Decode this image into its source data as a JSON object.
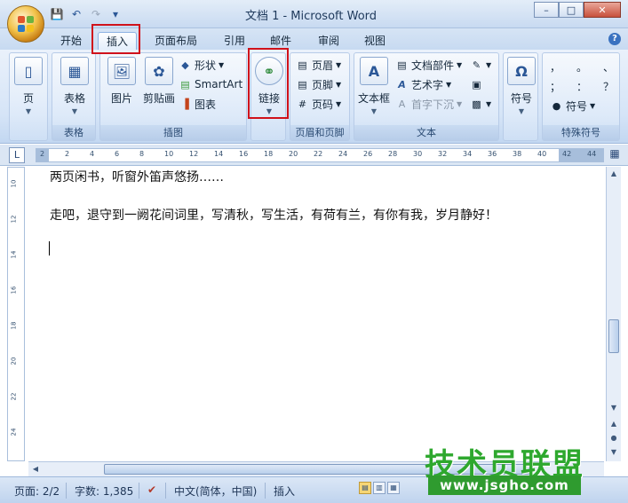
{
  "window": {
    "title": "文档 1 - Microsoft Word",
    "controls": {
      "minimize": "–",
      "maximize": "□",
      "close": "✕"
    }
  },
  "quick_access": {
    "icons": [
      "save-icon",
      "undo-icon",
      "redo-icon",
      "customize-icon"
    ]
  },
  "tabs": [
    {
      "label": "开始"
    },
    {
      "label": "插入",
      "active": true
    },
    {
      "label": "页面布局"
    },
    {
      "label": "引用"
    },
    {
      "label": "邮件"
    },
    {
      "label": "审阅"
    },
    {
      "label": "视图"
    }
  ],
  "ribbon": {
    "groups": {
      "pages": {
        "label": "",
        "button": "页"
      },
      "tables": {
        "label": "表格",
        "button": "表格"
      },
      "illustrations": {
        "label": "插图",
        "picture": "图片",
        "clipart": "剪贴画",
        "shapes": "形状",
        "smartart": "SmartArt",
        "chart": "图表"
      },
      "links": {
        "label": "",
        "button": "链接"
      },
      "header_footer": {
        "label": "页眉和页脚",
        "header": "页眉",
        "footer": "页脚",
        "page_number": "页码"
      },
      "text": {
        "label": "文本",
        "textbox": "文本框",
        "quickparts": "文档部件",
        "wordart": "艺术字",
        "dropcap": "首字下沉"
      },
      "symbols": {
        "label": "",
        "button": "符号"
      },
      "special": {
        "label": "特殊符号",
        "row1": [
          "，",
          "。",
          "、"
        ],
        "row2": [
          "；",
          "：",
          "？"
        ],
        "symbol": "符号"
      }
    }
  },
  "ruler": {
    "ticks": [
      "2",
      "2",
      "4",
      "6",
      "8",
      "10",
      "12",
      "14",
      "16",
      "18",
      "20",
      "22",
      "24",
      "26",
      "28",
      "30",
      "32",
      "34",
      "36",
      "38",
      "40",
      "42",
      "44"
    ],
    "vticks": [
      "10",
      "12",
      "14",
      "16",
      "18",
      "20",
      "22",
      "24"
    ]
  },
  "document": {
    "lines": [
      "两页闲书，听窗外笛声悠扬……",
      "走吧，退守到一阙花间词里，写清秋，写生活，有荷有兰，有你有我，岁月静好！"
    ]
  },
  "status": {
    "page": "页面: 2/2",
    "words": "字数: 1,385",
    "language": "中文(简体，中国)",
    "mode": "插入"
  },
  "watermark": {
    "title": "技术员联盟",
    "url": "www.jsgho.com"
  }
}
